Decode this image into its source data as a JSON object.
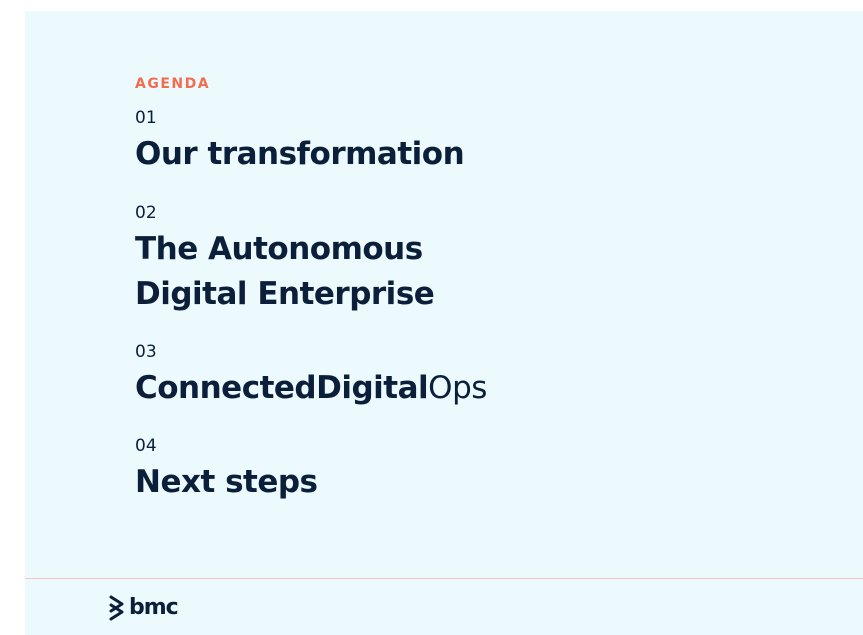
{
  "agenda": {
    "label": "AGENDA",
    "items": [
      {
        "number": "01",
        "title_lines": [
          "Our transformation"
        ]
      },
      {
        "number": "02",
        "title_lines": [
          "The Autonomous",
          "Digital Enterprise"
        ]
      },
      {
        "number": "03",
        "title_bold": "ConnectedDigital",
        "title_light": "Ops"
      },
      {
        "number": "04",
        "title_lines": [
          "Next steps"
        ]
      }
    ]
  },
  "footer": {
    "logo_text": "bmc",
    "logo_icon": "bmc-chevron-icon"
  },
  "colors": {
    "background": "#ecfafe",
    "accent": "#f26c4f",
    "text": "#0b1f3a",
    "divider": "#f3c4b8"
  }
}
